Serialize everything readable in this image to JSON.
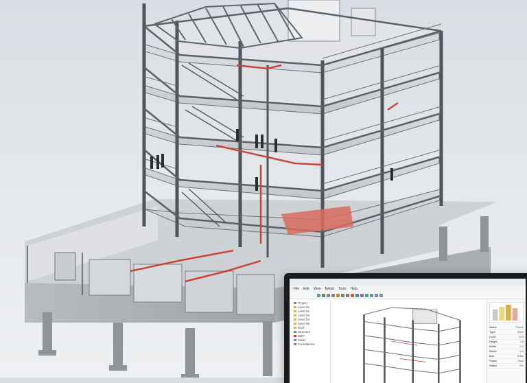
{
  "software": {
    "menu": [
      "File",
      "Edit",
      "View",
      "Model",
      "Tools",
      "Help"
    ],
    "toolbar_buttons": [
      "open",
      "save",
      "undo",
      "redo",
      "select",
      "move",
      "rotate",
      "measure",
      "section",
      "layers",
      "render",
      "settings",
      "export",
      "print"
    ],
    "project_tree": [
      {
        "label": "Project",
        "color": "#888888"
      },
      {
        "label": "Level 01",
        "color": "#c9b45a"
      },
      {
        "label": "Level 02",
        "color": "#c9b45a"
      },
      {
        "label": "Level 03",
        "color": "#c9b45a"
      },
      {
        "label": "Level 04",
        "color": "#c9b45a"
      },
      {
        "label": "Level 05",
        "color": "#c9b45a"
      },
      {
        "label": "Roof",
        "color": "#c9b45a"
      },
      {
        "label": "Structure",
        "color": "#7a8a99"
      },
      {
        "label": "MEP",
        "color": "#c04a3a"
      },
      {
        "label": "Stairs",
        "color": "#7a8a99"
      },
      {
        "label": "Foundations",
        "color": "#7a8a99"
      }
    ],
    "properties": [
      {
        "k": "Name",
        "v": "Frame"
      },
      {
        "k": "Type",
        "v": "Steel"
      },
      {
        "k": "Level",
        "v": "L03"
      },
      {
        "k": "Height",
        "v": "3.6"
      },
      {
        "k": "Width",
        "v": "0.4"
      },
      {
        "k": "Depth",
        "v": "0.4"
      },
      {
        "k": "Mat.",
        "v": "S355"
      },
      {
        "k": "Phase",
        "v": "New"
      },
      {
        "k": "Status",
        "v": "OK"
      }
    ],
    "colors": {
      "steel": "#5b6066",
      "concrete": "#b9bdc1",
      "mep": "#c8453a",
      "accent": "#d9b24a"
    }
  }
}
